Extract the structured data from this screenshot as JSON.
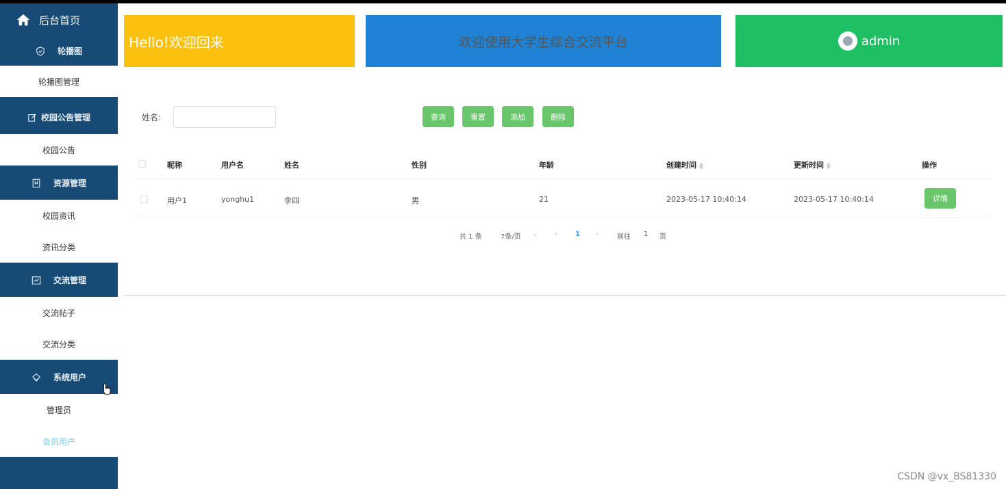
{
  "sidebar": {
    "home_label": "后台首页",
    "sections": [
      {
        "label": "轮播图",
        "items": [
          "轮播图管理"
        ]
      },
      {
        "label": "校园公告管理",
        "items": [
          "校园公告"
        ]
      },
      {
        "label": "资源管理",
        "items": [
          "校园资讯",
          "资讯分类"
        ]
      },
      {
        "label": "交流管理",
        "items": [
          "交流帖子",
          "交流分类"
        ]
      },
      {
        "label": "系统用户",
        "items": [
          "管理员",
          "会员用户"
        ]
      }
    ]
  },
  "header": {
    "welcome": "Hello!欢迎回来",
    "platform_title": "欢迎使用大学生综合交流平台",
    "user": "admin"
  },
  "search": {
    "name_label": "姓名:",
    "name_value": "",
    "buttons": {
      "query": "查询",
      "reset": "重置",
      "add": "添加",
      "delete": "删除"
    }
  },
  "table": {
    "columns": [
      "昵称",
      "用户名",
      "姓名",
      "性别",
      "年龄",
      "创建时间",
      "更新时间",
      "操作"
    ],
    "rows": [
      {
        "nickname": "用户1",
        "username": "yonghu1",
        "name": "李四",
        "gender": "男",
        "age": "21",
        "created": "2023-05-17 10:40:14",
        "updated": "2023-05-17 10:40:14",
        "action": "详情"
      }
    ]
  },
  "pagination": {
    "total": "共 1 条",
    "page_size": "7条/页",
    "current_page": "1",
    "goto_prefix": "前往",
    "goto_value": "1",
    "goto_suffix": "页"
  },
  "watermark": "CSDN @vx_BS81330",
  "colors": {
    "sidebar": "#174b76",
    "yellow": "#fcc10e",
    "blue": "#1f82d4",
    "green": "#1fbf63",
    "button_green": "#6ac66a"
  }
}
